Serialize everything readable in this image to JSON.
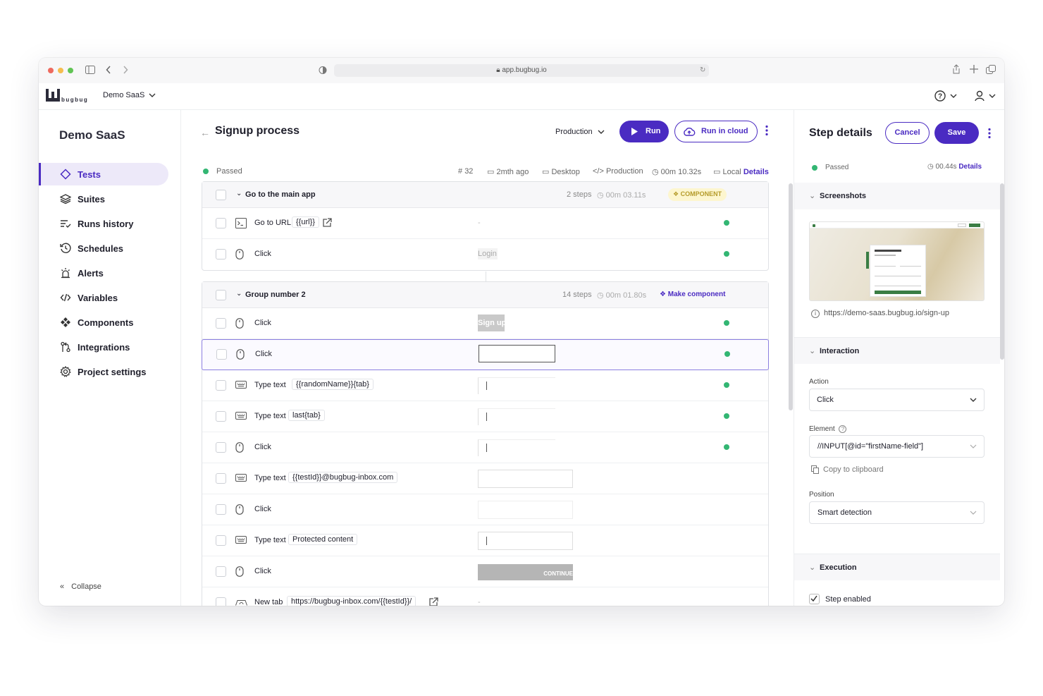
{
  "browser": {
    "url": "app.bugbug.io"
  },
  "app": {
    "logo_text": "bugbug",
    "project_selector": "Demo SaaS"
  },
  "sidebar": {
    "project_title": "Demo SaaS",
    "items": [
      {
        "label": "Tests"
      },
      {
        "label": "Suites"
      },
      {
        "label": "Runs history"
      },
      {
        "label": "Schedules"
      },
      {
        "label": "Alerts"
      },
      {
        "label": "Variables"
      },
      {
        "label": "Components"
      },
      {
        "label": "Integrations"
      },
      {
        "label": "Project settings"
      }
    ],
    "collapse": "Collapse"
  },
  "test": {
    "title": "Signup process",
    "environment": "Production",
    "run": "Run",
    "run_cloud": "Run in cloud",
    "status": "Passed",
    "meta": {
      "run_number": "32",
      "time": "2mth ago",
      "device": "Desktop",
      "env": "Production",
      "duration": "00m 10.32s",
      "location": "Local",
      "details": "Details"
    }
  },
  "groups": [
    {
      "name": "Go to the main app",
      "steps_count": "2 steps",
      "duration": "00m 03.11s",
      "badge": "COMPONENT",
      "steps": [
        {
          "type": "Go to URL",
          "value": "{{url}}",
          "preview": "-"
        },
        {
          "type": "Click",
          "value": "",
          "preview": "Login"
        }
      ]
    },
    {
      "name": "Group number 2",
      "steps_count": "14 steps",
      "duration": "00m 01.80s",
      "action": "Make component",
      "steps": [
        {
          "type": "Click",
          "value": "",
          "preview": "Sign up"
        },
        {
          "type": "Click",
          "value": "",
          "preview": ""
        },
        {
          "type": "Type text",
          "value": "{{randomName}}{tab}",
          "preview": ""
        },
        {
          "type": "Type text",
          "value": "last{tab}",
          "preview": ""
        },
        {
          "type": "Click",
          "value": "",
          "preview": ""
        },
        {
          "type": "Type text",
          "value": "{{testId}}@bugbug-inbox.com",
          "preview": ""
        },
        {
          "type": "Click",
          "value": "",
          "preview": ""
        },
        {
          "type": "Type text",
          "value": "Protected content",
          "preview": ""
        },
        {
          "type": "Click",
          "value": "",
          "preview": "CONTINUE"
        },
        {
          "type": "New tab",
          "value": "https://bugbug-inbox.com/{{testId}}/",
          "preview": "-"
        }
      ]
    }
  ],
  "details": {
    "title": "Step details",
    "cancel": "Cancel",
    "save": "Save",
    "status": "Passed",
    "duration": "00.44s",
    "details_link": "Details",
    "screenshots": {
      "title": "Screenshots",
      "url": "https://demo-saas.bugbug.io/sign-up"
    },
    "interaction": {
      "title": "Interaction",
      "action_label": "Action",
      "action_value": "Click",
      "element_label": "Element",
      "element_value": "//INPUT[@id=\"firstName-field\"]",
      "copy": "Copy to clipboard",
      "position_label": "Position",
      "position_value": "Smart detection"
    },
    "execution": {
      "title": "Execution",
      "step_enabled": "Step enabled"
    }
  },
  "colors": {
    "accent": "#4a2bc2",
    "success": "#33b673",
    "component_badge_bg": "#fdf6cf"
  }
}
